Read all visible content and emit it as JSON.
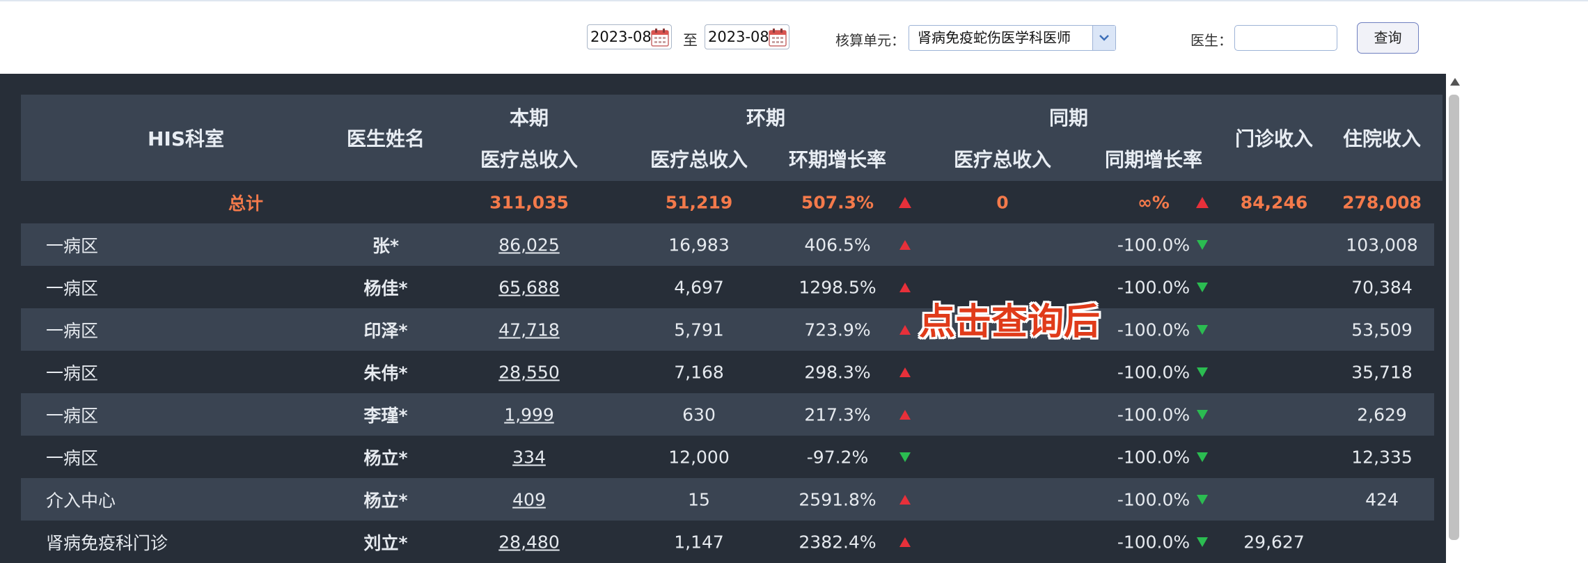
{
  "toolbar": {
    "start_date": "2023-08",
    "to_label": "至",
    "end_date": "2023-08",
    "unit_label": "核算单元：",
    "unit_value": "肾病免疫蛇伤医学科医师",
    "doctor_label": "医生：",
    "doctor_value": "",
    "query_button": "查询"
  },
  "table": {
    "headers": {
      "his_dept": "HIS科室",
      "doctor_name": "医生姓名",
      "current_period": "本期",
      "mom_period": "环期",
      "yoy_period": "同期",
      "total_income": "医疗总收入",
      "mom_total_income": "医疗总收入",
      "mom_growth": "环期增长率",
      "yoy_total_income": "医疗总收入",
      "yoy_growth": "同期增长率",
      "outpatient_income": "门诊收入",
      "inpatient_income": "住院收入"
    },
    "total": {
      "label": "总计",
      "current": "311,035",
      "mom_income": "51,219",
      "mom_growth": "507.3%",
      "mom_trend": "up",
      "yoy_income": "0",
      "yoy_growth": "∞%",
      "yoy_trend": "up",
      "outpatient": "84,246",
      "inpatient": "278,008"
    },
    "rows": [
      {
        "dept": "一病区",
        "doctor": "张*",
        "current": "86,025",
        "mom_income": "16,983",
        "mom_growth": "406.5%",
        "mom_trend": "up",
        "yoy_income": "",
        "yoy_growth": "-100.0%",
        "yoy_trend": "down",
        "outpatient": "",
        "inpatient": "103,008"
      },
      {
        "dept": "一病区",
        "doctor": "杨佳*",
        "current": "65,688",
        "mom_income": "4,697",
        "mom_growth": "1298.5%",
        "mom_trend": "up",
        "yoy_income": "",
        "yoy_growth": "-100.0%",
        "yoy_trend": "down",
        "outpatient": "",
        "inpatient": "70,384"
      },
      {
        "dept": "一病区",
        "doctor": "印泽*",
        "current": "47,718",
        "mom_income": "5,791",
        "mom_growth": "723.9%",
        "mom_trend": "up",
        "yoy_income": "",
        "yoy_growth": "-100.0%",
        "yoy_trend": "down",
        "outpatient": "",
        "inpatient": "53,509"
      },
      {
        "dept": "一病区",
        "doctor": "朱伟*",
        "current": "28,550",
        "mom_income": "7,168",
        "mom_growth": "298.3%",
        "mom_trend": "up",
        "yoy_income": "",
        "yoy_growth": "-100.0%",
        "yoy_trend": "down",
        "outpatient": "",
        "inpatient": "35,718"
      },
      {
        "dept": "一病区",
        "doctor": "李瑾*",
        "current": "1,999",
        "mom_income": "630",
        "mom_growth": "217.3%",
        "mom_trend": "up",
        "yoy_income": "",
        "yoy_growth": "-100.0%",
        "yoy_trend": "down",
        "outpatient": "",
        "inpatient": "2,629"
      },
      {
        "dept": "一病区",
        "doctor": "杨立*",
        "current": "334",
        "mom_income": "12,000",
        "mom_growth": "-97.2%",
        "mom_trend": "down",
        "yoy_income": "",
        "yoy_growth": "-100.0%",
        "yoy_trend": "down",
        "outpatient": "",
        "inpatient": "12,335"
      },
      {
        "dept": "介入中心",
        "doctor": "杨立*",
        "current": "409",
        "mom_income": "15",
        "mom_growth": "2591.8%",
        "mom_trend": "up",
        "yoy_income": "",
        "yoy_growth": "-100.0%",
        "yoy_trend": "down",
        "outpatient": "",
        "inpatient": "424"
      },
      {
        "dept": "肾病免疫科门诊",
        "doctor": "刘立*",
        "current": "28,480",
        "mom_income": "1,147",
        "mom_growth": "2382.4%",
        "mom_trend": "up",
        "yoy_income": "",
        "yoy_growth": "-100.0%",
        "yoy_trend": "down",
        "outpatient": "29,627",
        "inpatient": ""
      }
    ]
  },
  "annotation": "点击查询后",
  "colors": {
    "report_bg": "#272e38",
    "header_bg": "#3a4452",
    "row_even": "#272e38",
    "row_odd": "#3a4452",
    "total_text": "#f47a4b",
    "trend_up": "#e7303a",
    "trend_down": "#2bbc51"
  },
  "icons": {
    "calendar": "calendar-icon",
    "dropdown": "chevron-down-icon",
    "trend_up": "triangle-up-icon",
    "trend_down": "triangle-down-icon"
  }
}
